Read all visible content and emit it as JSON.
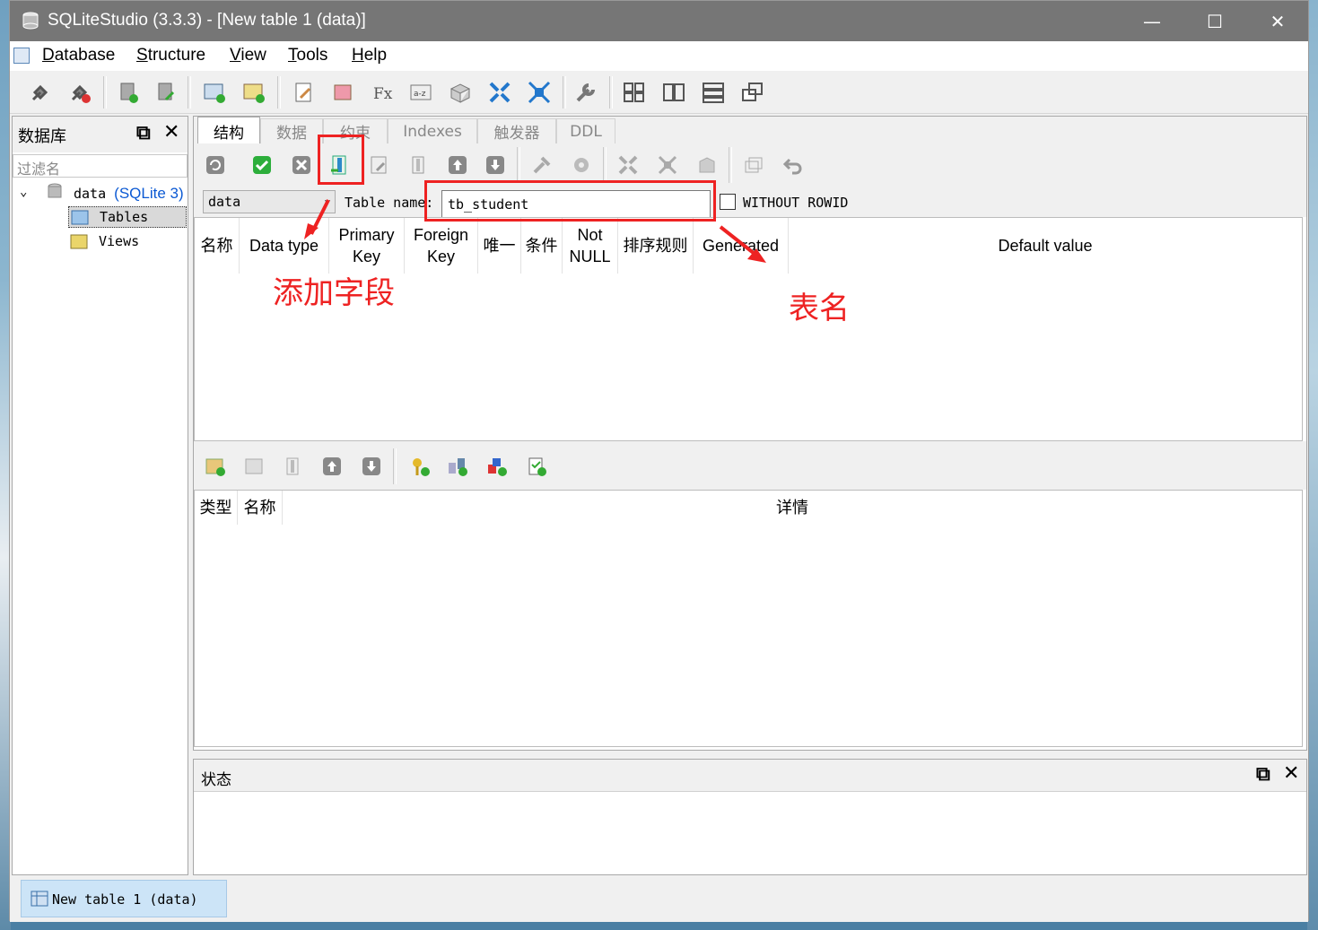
{
  "window": {
    "title": "SQLiteStudio (3.3.3) - [New table 1 (data)]",
    "minimize": "—",
    "maximize": "☐",
    "close": "✕"
  },
  "menu": [
    {
      "label": "Database",
      "accel": "D",
      "rest": "atabase"
    },
    {
      "label": "Structure",
      "accel": "S",
      "rest": "tructure"
    },
    {
      "label": "View",
      "accel": "V",
      "rest": "iew"
    },
    {
      "label": "Tools",
      "accel": "T",
      "rest": "ools"
    },
    {
      "label": "Help",
      "accel": "H",
      "rest": "elp"
    }
  ],
  "db_panel": {
    "title": "数据库",
    "filter_placeholder": "过滤名",
    "database": {
      "name": "data",
      "type": "(SQLite 3)"
    },
    "items": [
      "Tables",
      "Views"
    ]
  },
  "editor": {
    "tabs": [
      "结构",
      "数据",
      "约束",
      "Indexes",
      "触发器",
      "DDL"
    ],
    "db_select": "data",
    "table_name_label": "Table name:",
    "table_name": "tb_student",
    "without_rowid": "WITHOUT ROWID",
    "column_headers": [
      "名称",
      "Data type",
      "Primary Key",
      "Foreign Key",
      "唯一",
      "条件",
      "Not NULL",
      "排序规则",
      "Generated",
      "Default value"
    ],
    "constraint_headers": [
      "类型",
      "名称",
      "详情"
    ]
  },
  "status_panel": {
    "title": "状态"
  },
  "taskbar": {
    "item": "New table 1 (data)"
  },
  "annotations": {
    "add_field": "添加字段",
    "table_name": "表名",
    "color": "#ee2222"
  }
}
